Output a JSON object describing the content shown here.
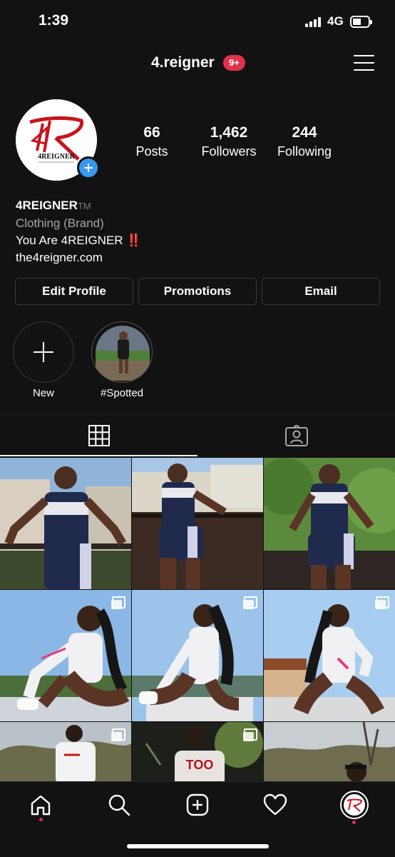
{
  "status_bar": {
    "time": "1:39",
    "network": "4G"
  },
  "header": {
    "username": "4.reigner",
    "notification_badge": "9+"
  },
  "profile": {
    "avatar_logo_text": "4REIGNER",
    "stats": [
      {
        "value": "66",
        "label": "Posts"
      },
      {
        "value": "1,462",
        "label": "Followers"
      },
      {
        "value": "244",
        "label": "Following"
      }
    ],
    "bio": {
      "name": "4REIGNER",
      "trademark": "TM",
      "category": "Clothing (Brand)",
      "text": "You Are 4REIGNER",
      "emphasis": "‼️",
      "link": "the4reigner.com"
    },
    "buttons": {
      "edit_profile": "Edit Profile",
      "promotions": "Promotions",
      "email": "Email"
    }
  },
  "highlights": [
    {
      "label": "New"
    },
    {
      "label": "#Spotted"
    }
  ],
  "tabs": {
    "active": "grid",
    "items": [
      "grid-icon",
      "tagged-icon"
    ]
  },
  "colors": {
    "background": "#121212",
    "accent": "#3897f0",
    "badge": "#e0334b"
  }
}
